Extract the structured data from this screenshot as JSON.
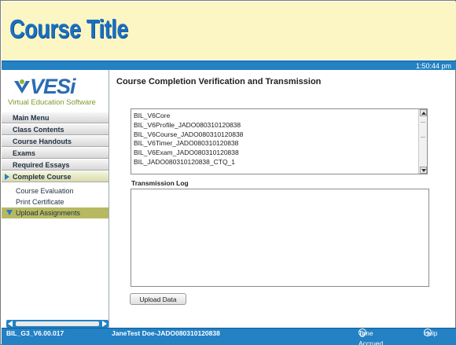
{
  "header": {
    "course_title": "Course Title",
    "clock": "1:50:44 pm"
  },
  "logo": {
    "name": "VESi",
    "tagline": "Virtual Education Software",
    "colors": {
      "primary": "#2c6cb2",
      "accent": "#7d9a2b"
    }
  },
  "sidebar": {
    "items": [
      {
        "label": "Main Menu"
      },
      {
        "label": "Class Contents"
      },
      {
        "label": "Course Handouts"
      },
      {
        "label": "Exams"
      },
      {
        "label": "Required Essays"
      },
      {
        "label": "Complete Course"
      }
    ],
    "subitems": [
      {
        "label": "Course Evaluation"
      },
      {
        "label": "Print Certificate"
      },
      {
        "label": "Upload Assignments"
      }
    ]
  },
  "main": {
    "title": "Course Completion Verification and Transmission",
    "files": [
      "BIL_V6Core",
      "BIL_V6Profile_JADO080310120838",
      "BIL_V6Course_JADO080310120838",
      "BIL_V6Timer_JADO080310120838",
      "BIL_V6Exam_JADO080310120838",
      "BIL_JADO080310120838_CTQ_1"
    ],
    "log_label": "Transmission Log",
    "log_text": "",
    "upload_label": "Upload Data"
  },
  "footer": {
    "version": "BIL_G3_V6.00.017",
    "user": "JaneTest Doe-JADO080310120838",
    "time_accrued": "Time Accrued",
    "help": "Help"
  },
  "colors": {
    "header_bg": "#fbf6c4",
    "bar_blue": "#2381c4",
    "title_blue": "#1a6fc0",
    "active_sub": "#b7b962"
  }
}
